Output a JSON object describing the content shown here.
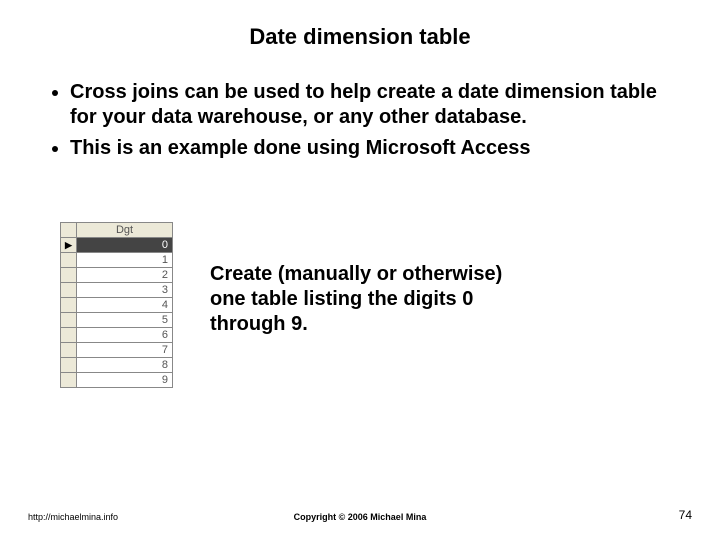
{
  "title": "Date dimension table",
  "bullets": [
    "Cross joins can be used to help create a date dimension table for your data warehouse, or any other database.",
    "This is an example done using Microsoft Access"
  ],
  "table": {
    "header": "Dgt",
    "selector_mark": "▶",
    "rows": [
      "0",
      "1",
      "2",
      "3",
      "4",
      "5",
      "6",
      "7",
      "8",
      "9"
    ]
  },
  "callout": "Create (manually or otherwise) one table listing the digits 0 through 9.",
  "footer": {
    "left": "http://michaelmina.info",
    "center": "Copyright © 2006 Michael Mina",
    "right": "74"
  }
}
